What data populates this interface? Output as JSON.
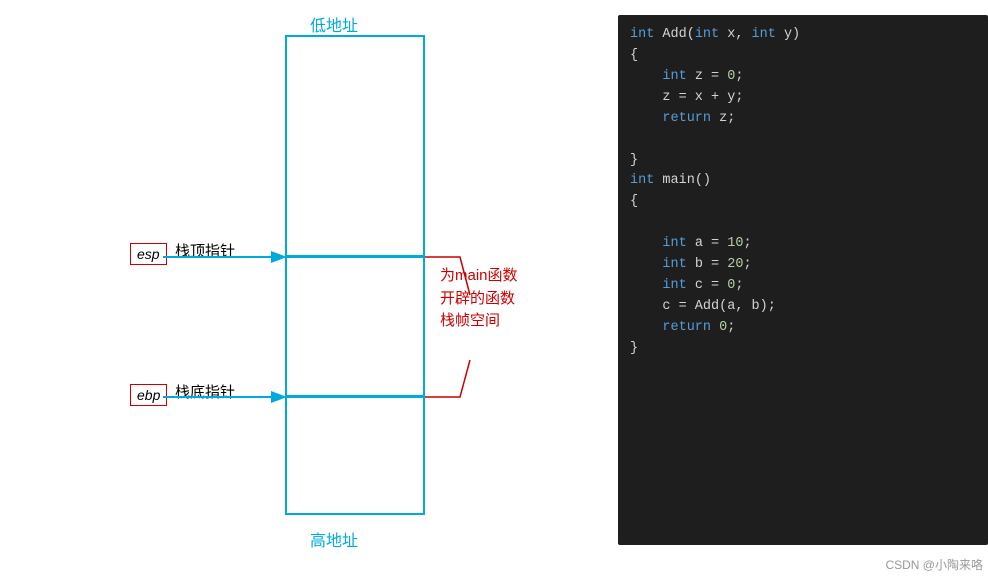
{
  "labels": {
    "low_address": "低地址",
    "high_address": "高地址",
    "esp_label": "esp",
    "ebp_label": "ebp",
    "stack_top_pointer": "栈顶指针",
    "stack_bottom_pointer": "栈底指针",
    "main_frame_line1": "为main函数",
    "main_frame_line2": "开辟的函数",
    "main_frame_line3": "栈帧空间",
    "watermark": "CSDN @小陶来咯"
  },
  "code": {
    "lines": [
      {
        "text": "int Add(int x, int y)",
        "parts": [
          {
            "type": "kw",
            "text": "int"
          },
          {
            "type": "plain",
            "text": " Add("
          },
          {
            "type": "kw",
            "text": "int"
          },
          {
            "type": "plain",
            "text": " x, "
          },
          {
            "type": "kw",
            "text": "int"
          },
          {
            "type": "plain",
            "text": " y)"
          }
        ]
      },
      {
        "text": "{",
        "parts": [
          {
            "type": "plain",
            "text": "{"
          }
        ]
      },
      {
        "text": "    int z = 0;",
        "parts": [
          {
            "type": "kw",
            "text": "    int"
          },
          {
            "type": "plain",
            "text": " z = "
          },
          {
            "type": "num",
            "text": "0"
          },
          {
            "type": "plain",
            "text": ";"
          }
        ]
      },
      {
        "text": "    z = x + y;",
        "parts": [
          {
            "type": "plain",
            "text": "    z = x + y;"
          }
        ]
      },
      {
        "text": "    return z;",
        "parts": [
          {
            "type": "kw",
            "text": "    return"
          },
          {
            "type": "plain",
            "text": " z;"
          }
        ]
      },
      {
        "text": "",
        "parts": []
      },
      {
        "text": "}",
        "parts": [
          {
            "type": "plain",
            "text": "}"
          }
        ]
      },
      {
        "text": "int main()",
        "parts": [
          {
            "type": "kw",
            "text": "int"
          },
          {
            "type": "plain",
            "text": " main()"
          }
        ]
      },
      {
        "text": "{",
        "parts": [
          {
            "type": "plain",
            "text": "{"
          }
        ]
      },
      {
        "text": "",
        "parts": []
      },
      {
        "text": "    int a = 10;",
        "parts": [
          {
            "type": "kw",
            "text": "    int"
          },
          {
            "type": "plain",
            "text": " a = "
          },
          {
            "type": "num",
            "text": "10"
          },
          {
            "type": "plain",
            "text": ";"
          }
        ]
      },
      {
        "text": "    int b = 20;",
        "parts": [
          {
            "type": "kw",
            "text": "    int"
          },
          {
            "type": "plain",
            "text": " b = "
          },
          {
            "type": "num",
            "text": "20"
          },
          {
            "type": "plain",
            "text": ";"
          }
        ]
      },
      {
        "text": "    int c = 0;",
        "parts": [
          {
            "type": "kw",
            "text": "    int"
          },
          {
            "type": "plain",
            "text": " c = "
          },
          {
            "type": "num",
            "text": "0"
          },
          {
            "type": "plain",
            "text": ";"
          }
        ]
      },
      {
        "text": "    c = Add(a, b);",
        "parts": [
          {
            "type": "plain",
            "text": "    c = Add(a, b);"
          }
        ]
      },
      {
        "text": "    return 0;",
        "parts": [
          {
            "type": "kw",
            "text": "    return"
          },
          {
            "type": "plain",
            "text": " "
          },
          {
            "type": "num",
            "text": "0"
          },
          {
            "type": "plain",
            "text": ";"
          }
        ]
      },
      {
        "text": "}",
        "parts": [
          {
            "type": "plain",
            "text": "}"
          }
        ]
      }
    ]
  },
  "colors": {
    "cyan_border": "#00aadd",
    "red_label": "#cc0000",
    "code_bg": "#1e1e1e",
    "code_kw": "#569cd6",
    "code_fn": "#dcdcaa",
    "code_num": "#b5cea8",
    "code_plain": "#d4d4d4"
  }
}
